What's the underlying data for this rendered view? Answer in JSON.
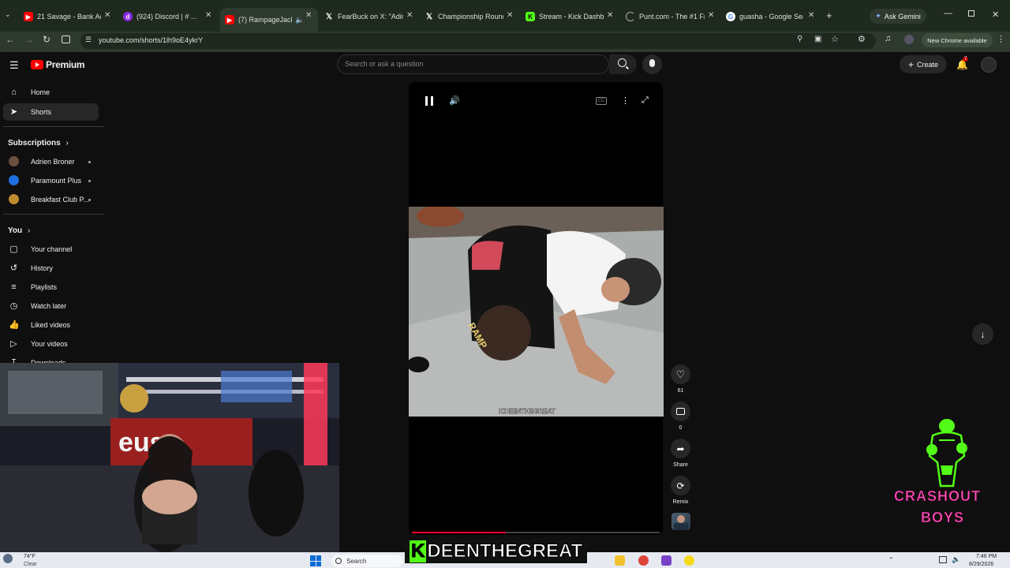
{
  "browser": {
    "tabs": [
      {
        "title": "21 Savage - Bank Acco",
        "icon": "youtube-icon",
        "color": "#ff0000"
      },
      {
        "title": "(924) Discord | # ...",
        "icon": "discord-icon",
        "color": "#8a2be2"
      },
      {
        "title": "(7) RampageJacks",
        "icon": "youtube-icon",
        "color": "#ff0000",
        "active": true
      },
      {
        "title": "FearBuck on X: \"Adin R",
        "icon": "x-icon",
        "color": "#000000"
      },
      {
        "title": "Championship Rounds",
        "icon": "x-icon",
        "color": "#000000"
      },
      {
        "title": "Stream - Kick Dashboa",
        "icon": "kick-icon",
        "color": "#53fc18"
      },
      {
        "title": "Punt.com - The #1 Free",
        "icon": "loading-icon",
        "color": "#888888"
      },
      {
        "title": "guasha - Google Searc",
        "icon": "google-icon",
        "color": "#4285f4"
      }
    ],
    "ask_gemini": "Ask Gemini",
    "url": "youtube.com/shorts/1lh9oE4ykrY",
    "new_chrome": "New Chrome available"
  },
  "youtube": {
    "logo_text": "Premium",
    "search_placeholder": "Search or ask a question",
    "create_label": "Create",
    "notification_count": "7",
    "sidebar": {
      "main": [
        {
          "label": "Home",
          "icon": "home-icon"
        },
        {
          "label": "Shorts",
          "icon": "shorts-icon",
          "active": true
        }
      ],
      "subscriptions_title": "Subscriptions",
      "subscriptions": [
        {
          "label": "Adrien Broner",
          "color": "#6b5040"
        },
        {
          "label": "Paramount Plus",
          "color": "#1f6fe0"
        },
        {
          "label": "Breakfast Club P...",
          "color": "#c08a30"
        }
      ],
      "you_title": "You",
      "you": [
        {
          "label": "Your channel",
          "icon": "channel-icon"
        },
        {
          "label": "History",
          "icon": "history-icon"
        },
        {
          "label": "Playlists",
          "icon": "playlists-icon"
        },
        {
          "label": "Watch later",
          "icon": "clock-icon"
        },
        {
          "label": "Liked videos",
          "icon": "thumbs-up-icon"
        },
        {
          "label": "Your videos",
          "icon": "video-icon"
        },
        {
          "label": "Downloads",
          "icon": "download-icon"
        }
      ]
    },
    "short": {
      "watermark": "KDEENTHEGREAT",
      "progress": 0.38,
      "likes": "61",
      "comments": "0",
      "share_label": "Share",
      "remix_label": "Remix"
    }
  },
  "overlay": {
    "caption": "DEENTHEGREAT",
    "caption_prefix": "K",
    "logo_line1": "CRASHOUT",
    "logo_line2": "BOYS",
    "logo_color": "#ff4fb8"
  },
  "taskbar": {
    "weather_temp": "74°F",
    "weather_desc": "Clear",
    "search_label": "Search",
    "time": "7:46 PM",
    "date": "8/29/2026"
  }
}
